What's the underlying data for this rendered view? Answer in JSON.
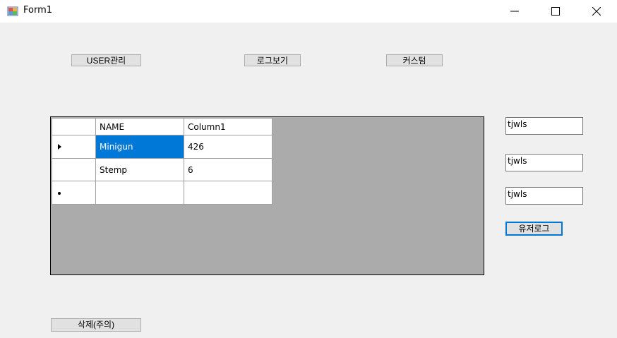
{
  "window": {
    "title": "Form1",
    "controls": [
      "minimize-icon",
      "maximize-icon",
      "close-icon"
    ]
  },
  "buttons": {
    "user_manage": "USER관리",
    "view_log": "로그보기",
    "custom": "커스텀",
    "user_log": "유저로그",
    "delete": "삭제(주의)"
  },
  "grid": {
    "columns": [
      "NAME",
      "Column1"
    ],
    "rows": [
      {
        "name": "Minigun",
        "col1": "426",
        "selected_cell": "name",
        "current": true
      },
      {
        "name": "Stemp",
        "col1": "6"
      },
      {
        "name": "",
        "col1": "",
        "new_row": true
      }
    ]
  },
  "textboxes": [
    "tjwls",
    "tjwls",
    "tjwls"
  ],
  "colors": {
    "selection": "#0078d7",
    "grid_bg": "#ababab",
    "form_bg": "#f0f0f0"
  }
}
